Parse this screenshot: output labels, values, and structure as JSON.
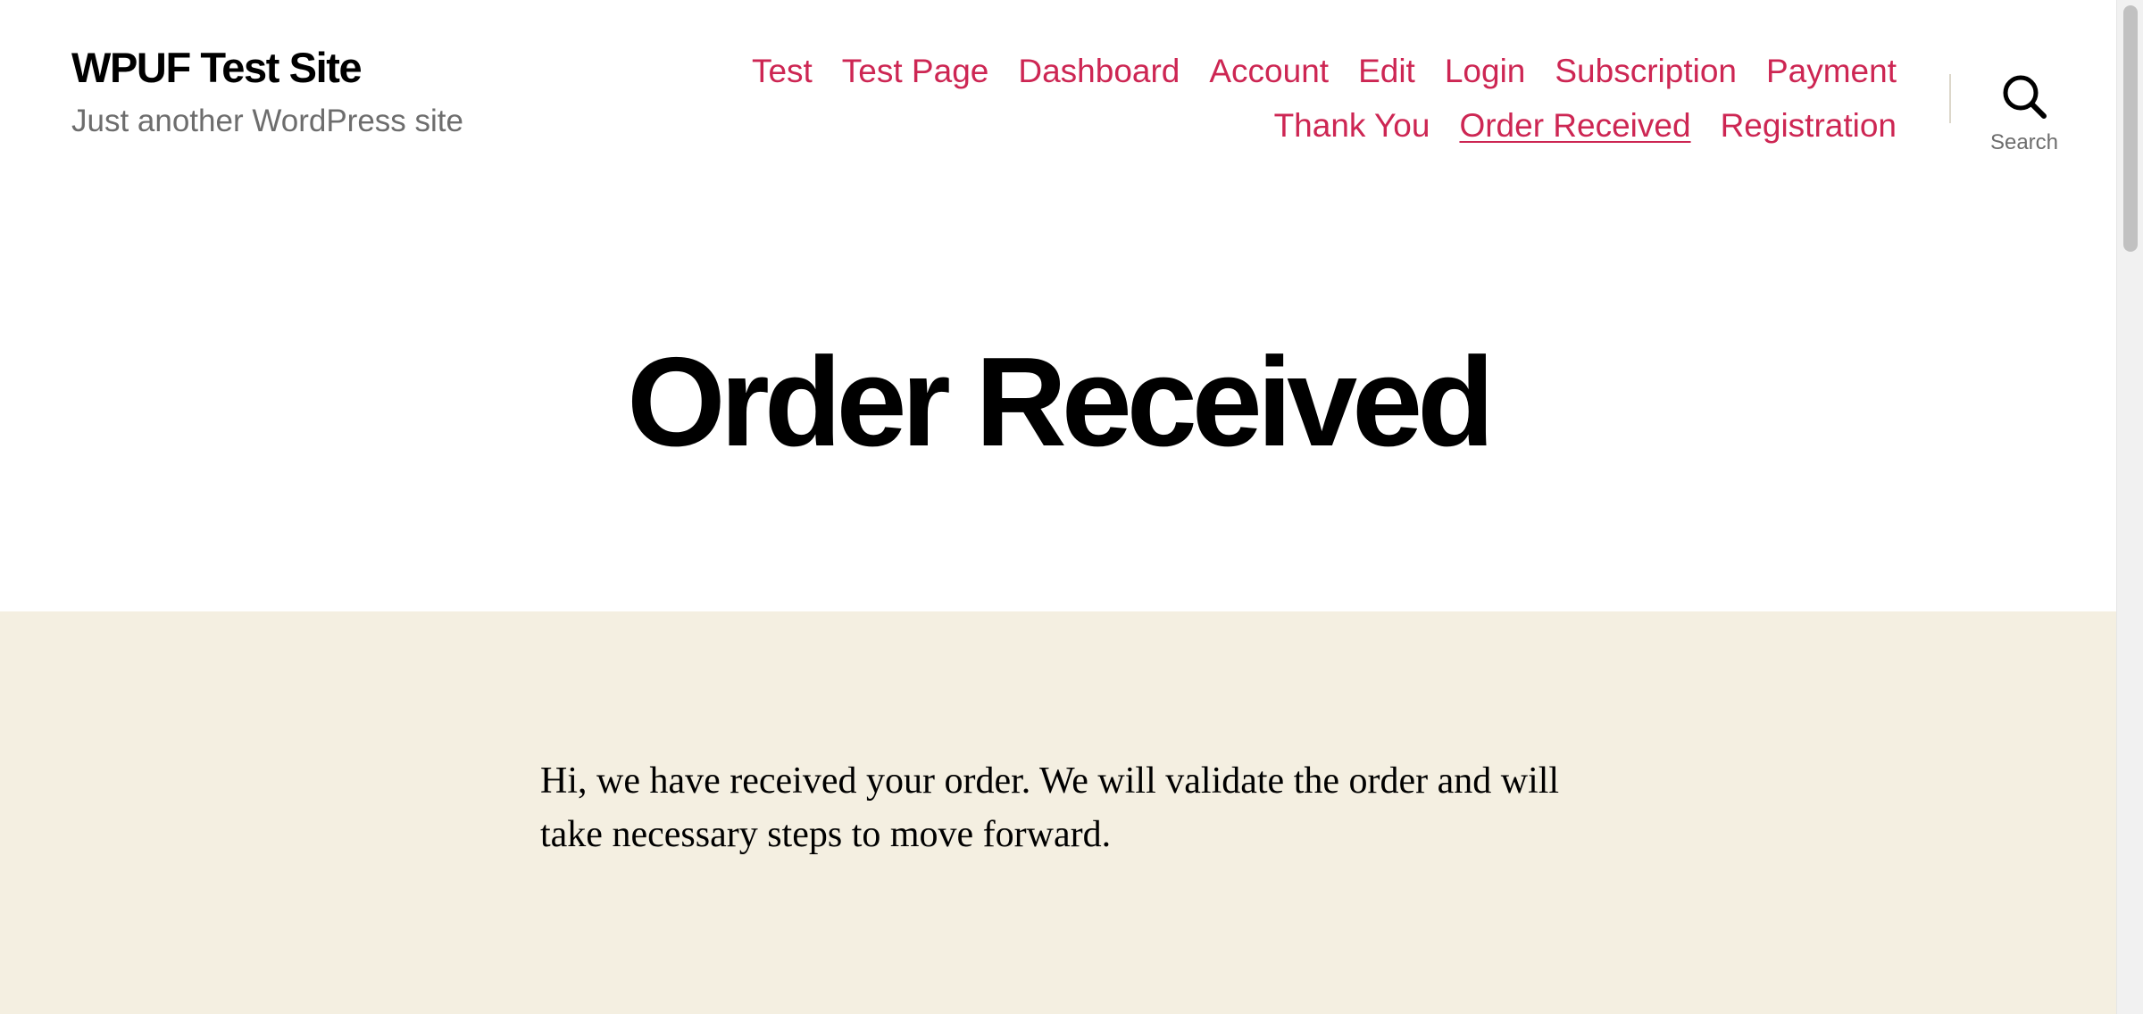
{
  "site": {
    "title": "WPUF Test Site",
    "description": "Just another WordPress site"
  },
  "menu": {
    "items": [
      {
        "label": "Test",
        "current": false
      },
      {
        "label": "Test Page",
        "current": false
      },
      {
        "label": "Dashboard",
        "current": false
      },
      {
        "label": "Account",
        "current": false
      },
      {
        "label": "Edit",
        "current": false
      },
      {
        "label": "Login",
        "current": false
      },
      {
        "label": "Subscription",
        "current": false
      },
      {
        "label": "Payment",
        "current": false
      },
      {
        "label": "Thank You",
        "current": false
      },
      {
        "label": "Order Received",
        "current": true
      },
      {
        "label": "Registration",
        "current": false
      }
    ]
  },
  "search": {
    "label": "Search",
    "icon": "search-icon"
  },
  "page": {
    "title": "Order Received",
    "content": "Hi, we have received your order. We will validate the order and will take necessary steps to move forward."
  },
  "colors": {
    "accent": "#cd2653",
    "muted_text": "#6d6d6d",
    "content_background": "#f4efe1",
    "divider": "#dcd7ca"
  }
}
